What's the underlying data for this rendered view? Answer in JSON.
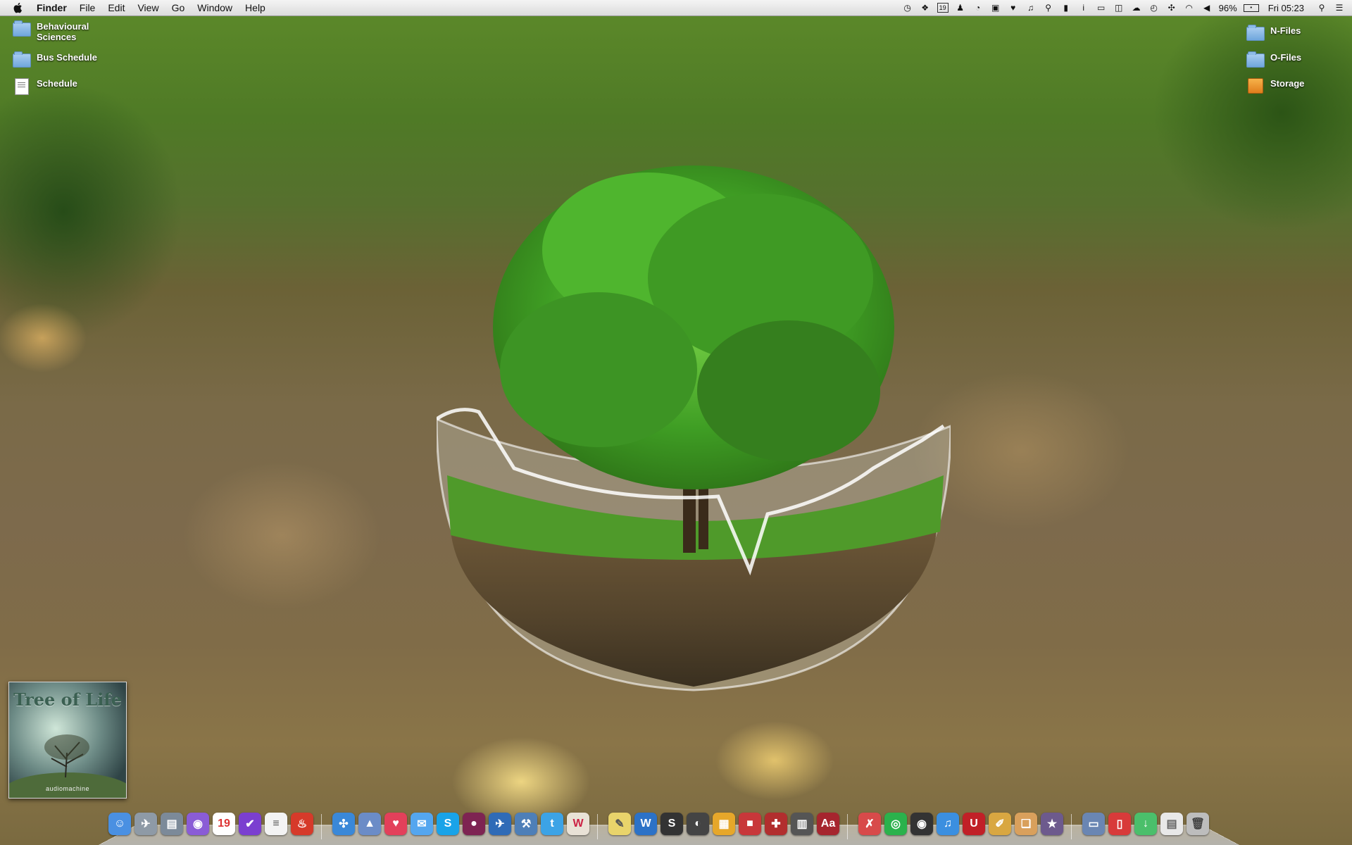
{
  "menubar": {
    "app_name": "Finder",
    "menus": [
      "File",
      "Edit",
      "View",
      "Go",
      "Window",
      "Help"
    ],
    "status": {
      "battery_percent": "96%",
      "clock": "Fri 05:23",
      "calendar_day": "19",
      "icons": [
        "clock-icon",
        "dropbox-icon",
        "calendar-icon",
        "notes-icon",
        "timer-icon",
        "contact-icon",
        "heart-icon",
        "music-note-icon",
        "pin-icon",
        "bookmark-icon",
        "info-icon",
        "window-icon",
        "airplay-icon",
        "cloud-icon",
        "time-machine-icon",
        "sync-icon",
        "wifi-icon",
        "volume-icon",
        "battery-icon",
        "search-icon",
        "list-icon"
      ]
    }
  },
  "desktop": {
    "left_items": [
      {
        "label": "Behavioural\nSciences",
        "kind": "folder"
      },
      {
        "label": "Bus Schedule",
        "kind": "folder"
      },
      {
        "label": "Schedule",
        "kind": "document"
      }
    ],
    "right_items": [
      {
        "label": "N-Files",
        "kind": "folder"
      },
      {
        "label": "O-Files",
        "kind": "folder"
      },
      {
        "label": "Storage",
        "kind": "drive"
      }
    ]
  },
  "widget": {
    "album_title": "Tree of Life",
    "album_artist": "audiomachine"
  },
  "dock": {
    "items": [
      {
        "name": "finder",
        "glyph": "☺",
        "color": "#4a90e2"
      },
      {
        "name": "launchpad",
        "glyph": "✈",
        "color": "#8e9aa6"
      },
      {
        "name": "mission-control",
        "glyph": "▤",
        "color": "#7c8a99"
      },
      {
        "name": "vpn",
        "glyph": "◉",
        "color": "#8a5cd6"
      },
      {
        "name": "calendar",
        "glyph": "19",
        "color": "#ffffff",
        "text": "#d33"
      },
      {
        "name": "omnifocus",
        "glyph": "✔",
        "color": "#7b3fd0"
      },
      {
        "name": "textedit",
        "glyph": "≡",
        "color": "#f3f3f3",
        "text": "#555"
      },
      {
        "name": "recipes",
        "glyph": "♨",
        "color": "#d63a2a"
      },
      {
        "sep": true
      },
      {
        "name": "safari",
        "glyph": "✣",
        "color": "#3a88d8"
      },
      {
        "name": "preview",
        "glyph": "▲",
        "color": "#6b8cc7"
      },
      {
        "name": "pocket",
        "glyph": "♥",
        "color": "#e3405a"
      },
      {
        "name": "messages",
        "glyph": "✉",
        "color": "#54a6ef"
      },
      {
        "name": "skype",
        "glyph": "S",
        "color": "#19a3e8"
      },
      {
        "name": "alfred",
        "glyph": "●",
        "color": "#7e2452"
      },
      {
        "name": "airmail",
        "glyph": "✈",
        "color": "#2f6bb7"
      },
      {
        "name": "xcode",
        "glyph": "⚒",
        "color": "#4e7fb8"
      },
      {
        "name": "twitter",
        "glyph": "t",
        "color": "#3ca3e6"
      },
      {
        "name": "wunderlist",
        "glyph": "W",
        "color": "#e9e2d6",
        "text": "#c24"
      },
      {
        "sep": true
      },
      {
        "name": "stickies",
        "glyph": "✎",
        "color": "#e9d46b",
        "text": "#555"
      },
      {
        "name": "word",
        "glyph": "W",
        "color": "#2c72c7"
      },
      {
        "name": "scrivener",
        "glyph": "S",
        "color": "#333333"
      },
      {
        "name": "disk-diag",
        "glyph": "◐",
        "color": "#444444"
      },
      {
        "name": "rubiks",
        "glyph": "▦",
        "color": "#e6a72a"
      },
      {
        "name": "cache",
        "glyph": "■",
        "color": "#c8373a"
      },
      {
        "name": "security",
        "glyph": "✚",
        "color": "#b22e2e"
      },
      {
        "name": "activity",
        "glyph": "▥",
        "color": "#555555"
      },
      {
        "name": "dictionary",
        "glyph": "Aa",
        "color": "#a6252e"
      },
      {
        "sep": true
      },
      {
        "name": "cleaner",
        "glyph": "✗",
        "color": "#d84a4a"
      },
      {
        "name": "spotify",
        "glyph": "◎",
        "color": "#2bb24c"
      },
      {
        "name": "camera",
        "glyph": "◉",
        "color": "#333333"
      },
      {
        "name": "itunes",
        "glyph": "♫",
        "color": "#3b8fe0"
      },
      {
        "name": "unicorn",
        "glyph": "U",
        "color": "#c12027"
      },
      {
        "name": "artstudio",
        "glyph": "✐",
        "color": "#d9a741"
      },
      {
        "name": "box",
        "glyph": "❏",
        "color": "#d9a05c"
      },
      {
        "name": "imovie",
        "glyph": "★",
        "color": "#6d5a8d"
      },
      {
        "sep": true
      },
      {
        "name": "file-viewer",
        "glyph": "▭",
        "color": "#6a86b3"
      },
      {
        "name": "popcorn",
        "glyph": "▯",
        "color": "#d83a3a"
      },
      {
        "name": "downloads",
        "glyph": "↓",
        "color": "#4bbf6b"
      },
      {
        "name": "documents",
        "glyph": "▤",
        "color": "#e8e8e8",
        "text": "#666"
      },
      {
        "name": "trash",
        "glyph": "🗑",
        "color": "#bdbdbd",
        "text": "#444"
      }
    ]
  }
}
